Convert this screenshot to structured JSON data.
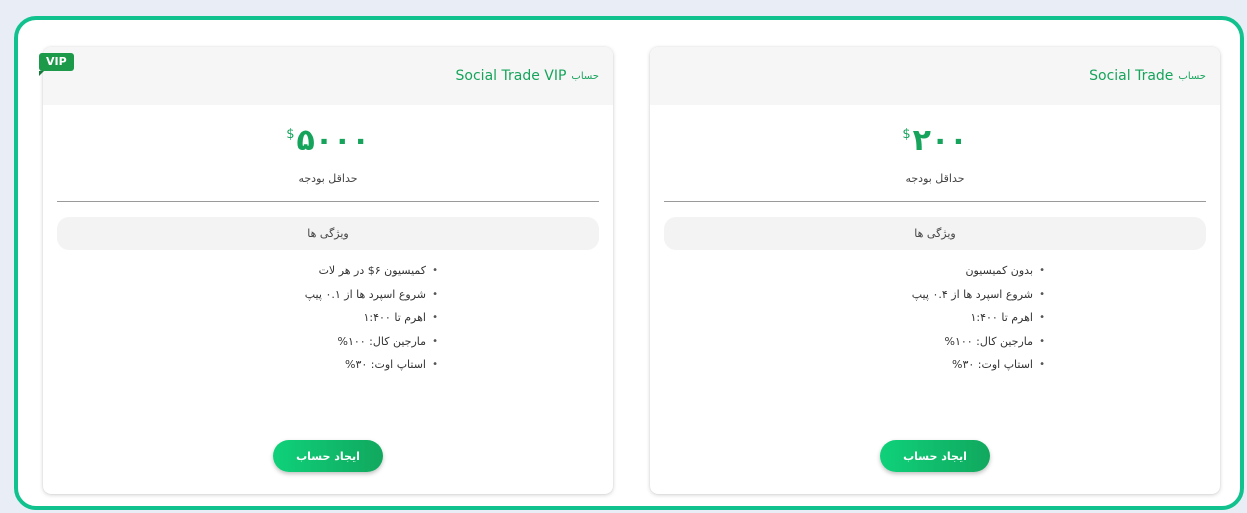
{
  "cards": [
    {
      "header_prefix": "حساب",
      "header_title": "Social Trade VIP",
      "badge": "VIP",
      "price_currency": "$",
      "price_amount": "۵۰۰۰",
      "min_budget_label": "حداقل بودجه",
      "features_title": "ویژگی ها",
      "features": [
        "کمیسیون ۶$ در هر لات",
        "شروع اسپرد ها از ۰.۱ پیپ",
        "اهرم تا ۱:۴۰۰",
        "مارجین کال: ۱۰۰%",
        "استاپ اوت: ۳۰%"
      ],
      "button_label": "ایجاد حساب"
    },
    {
      "header_prefix": "حساب",
      "header_title": "Social Trade",
      "price_currency": "$",
      "price_amount": "۲۰۰",
      "min_budget_label": "حداقل بودجه",
      "features_title": "ویژگی ها",
      "features": [
        "بدون کمیسیون",
        "شروع اسپرد ها از ۰.۴ پیپ",
        "اهرم تا ۱:۴۰۰",
        "مارجین کال: ۱۰۰%",
        "استاپ اوت: ۳۰%"
      ],
      "button_label": "ایجاد حساب"
    }
  ],
  "colors": {
    "accent_green": "#16a45c",
    "frame_border": "#12c28e",
    "badge": "#1c9a4a"
  }
}
